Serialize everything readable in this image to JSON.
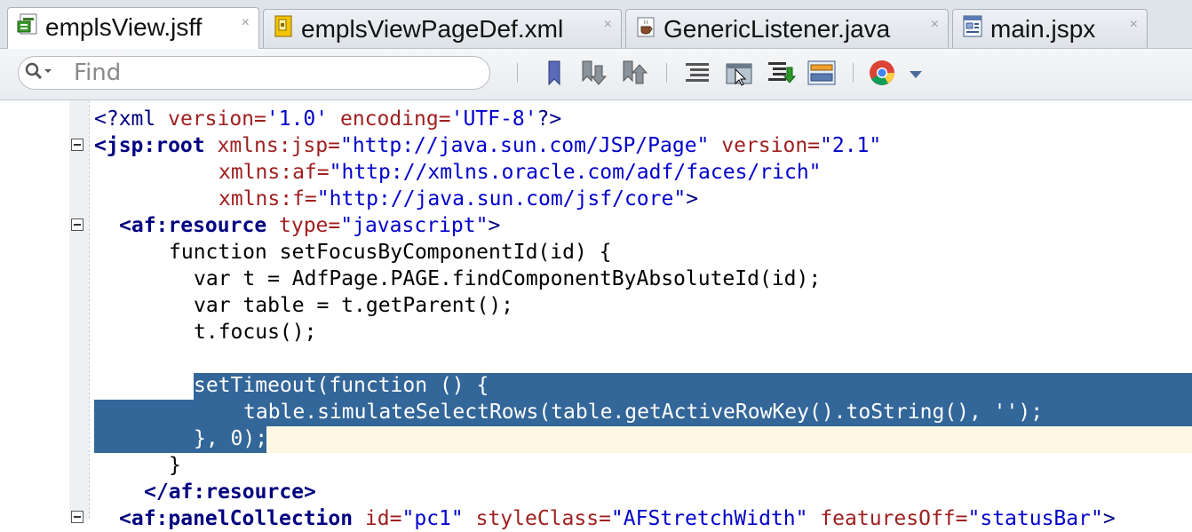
{
  "tabs": [
    {
      "label": "emplsView.jsff",
      "icon": "jsff-file-icon",
      "active": true
    },
    {
      "label": "emplsViewPageDef.xml",
      "icon": "pagedef-file-icon",
      "active": false
    },
    {
      "label": "GenericListener.java",
      "icon": "java-file-icon",
      "active": false
    },
    {
      "label": "main.jspx",
      "icon": "jspx-file-icon",
      "active": false
    }
  ],
  "tab_close_glyph": "×",
  "toolbar": {
    "search_placeholder": "Find",
    "icons": [
      "toggle-bookmark-icon",
      "previous-bookmark-icon",
      "next-bookmark-icon",
      "reformat-icon",
      "quick-doc-icon",
      "surround-with-icon",
      "structure-icon",
      "chrome-browser-icon",
      "dropdown-arrow-icon"
    ]
  },
  "code": {
    "line1": {
      "a": "<?xml ",
      "b": "version=",
      "c": "'1.0'",
      "d": " encoding=",
      "e": "'UTF-8'",
      "f": "?>"
    },
    "line2": {
      "a": "<jsp:root ",
      "b": "xmlns:jsp=",
      "c": "\"http://java.sun.com/JSP/Page\"",
      "d": " version=",
      "e": "\"2.1\""
    },
    "line3": {
      "b": "xmlns:af=",
      "c": "\"http://xmlns.oracle.com/adf/faces/rich\""
    },
    "line4": {
      "b": "xmlns:f=",
      "c": "\"http://java.sun.com/jsf/core\"",
      "d": ">"
    },
    "line5": {
      "a": "<af:resource ",
      "b": "type=",
      "c": "\"javascript\"",
      "d": ">"
    },
    "line6": "function setFocusByComponentId(id) {",
    "line7": "var t = AdfPage.PAGE.findComponentByAbsoluteId(id);",
    "line8": "var table = t.getParent();",
    "line9": "t.focus();",
    "line10": "setTimeout(function () {",
    "line11": "table.simulateSelectRows(table.getActiveRowKey().toString(), '');",
    "line12": "}, 0);",
    "line13": "}",
    "line14": "</af:resource>",
    "line15": {
      "a": "<af:panelCollection ",
      "b": "id=",
      "c": "\"pc1\"",
      "d": " styleClass=",
      "e": "\"AFStretchWidth\"",
      "f": " featuresOff=",
      "g": "\"statusBar\"",
      "h": ">"
    }
  },
  "colors": {
    "selection": "#336699",
    "tag": "#000080",
    "attribute": "#a02020",
    "string": "#0000cc",
    "caret_line": "#fdf7e3"
  }
}
